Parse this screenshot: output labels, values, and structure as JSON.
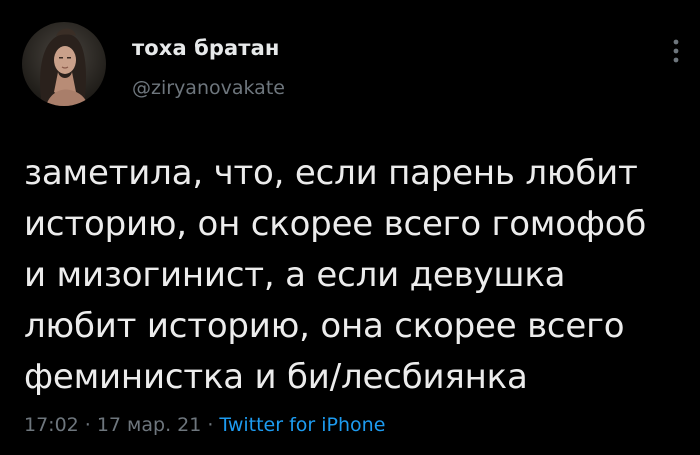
{
  "user": {
    "display_name": "тоха братан",
    "handle": "@ziryanovakate"
  },
  "tweet": {
    "lines": [
      "заметила, что, если парень любит",
      "историю, он скорее всего гомофоб",
      "и мизогинист, а если девушка",
      "любит историю, она скорее всего",
      "феминистка и би/лесбиянка"
    ]
  },
  "meta": {
    "time": "17:02",
    "separator": "·",
    "date": "17 мар. 21",
    "source": "Twitter for iPhone"
  },
  "icons": {
    "more": "vertical-ellipsis-icon",
    "avatar": "profile-photo"
  },
  "colors": {
    "background": "#000000",
    "text": "#e7e9ea",
    "secondary": "#6e767d",
    "link": "#1d9bf0"
  }
}
